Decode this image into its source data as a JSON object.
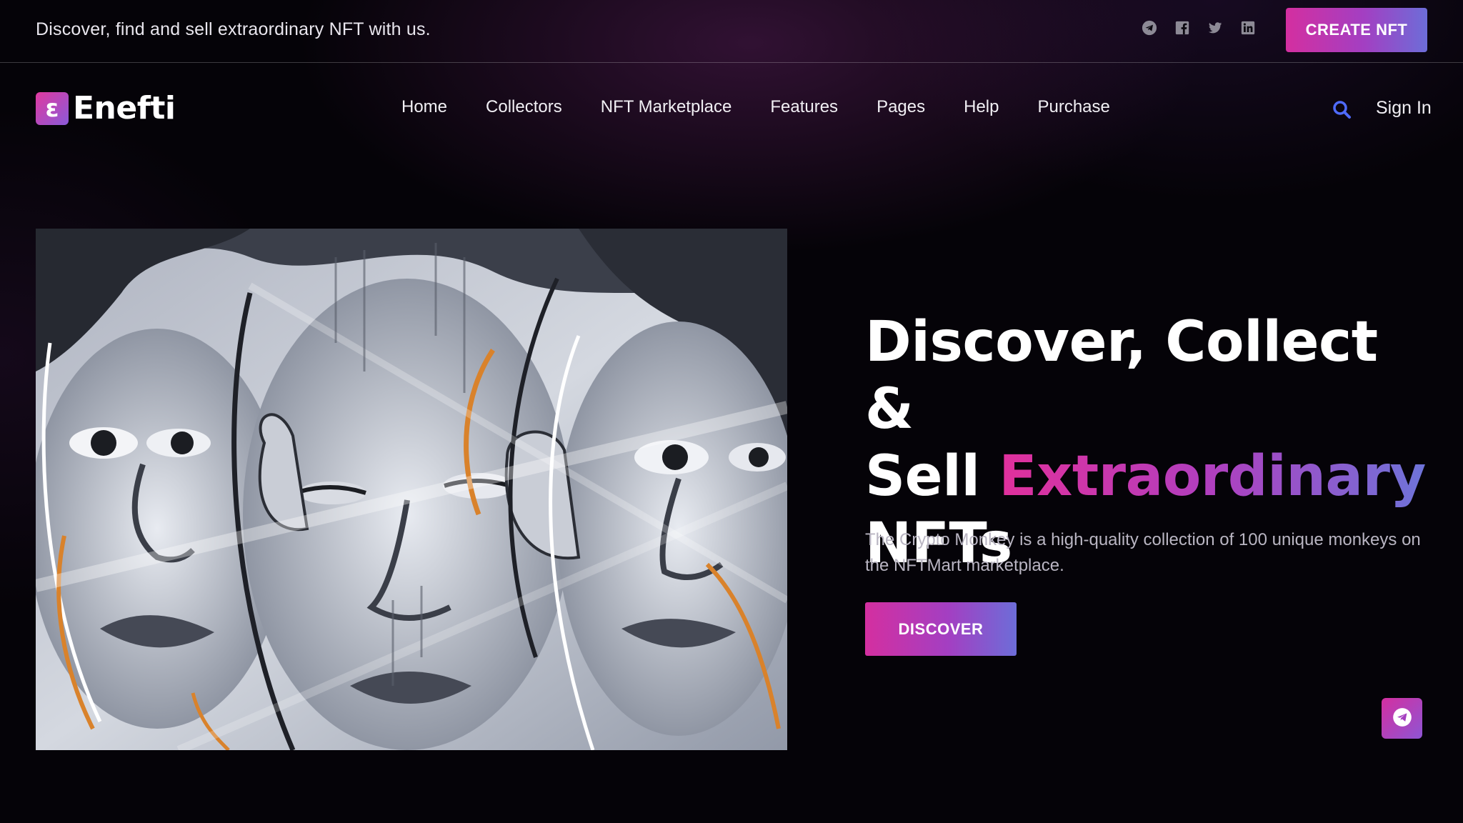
{
  "topbar": {
    "tagline": "Discover, find and sell extraordinary NFT with us.",
    "socials": [
      "telegram-icon",
      "facebook-icon",
      "twitter-icon",
      "linkedin-icon"
    ],
    "create_label": "CREATE NFT"
  },
  "logo": {
    "mark": "ɛ",
    "text": "Enefti"
  },
  "nav": {
    "items": [
      "Home",
      "Collectors",
      "NFT Marketplace",
      "Features",
      "Pages",
      "Help",
      "Purchase"
    ],
    "signin_label": "Sign In"
  },
  "hero": {
    "title_line1": "Discover, Collect &",
    "title_sell": "Sell ",
    "title_highlight": "Extraordinary",
    "title_line3": "NFTs",
    "description": "The Crypto Monkey is a high-quality collection of 100 unique monkeys on the NFTMart marketplace.",
    "cta_label": "DISCOVER",
    "image_icon": "graffiti-faces-artwork"
  },
  "floating": {
    "icon": "telegram-icon"
  },
  "colors": {
    "background": "#050308",
    "accent_pink": "#d42fa0",
    "accent_purple": "#a33fc2",
    "accent_blue": "#6d6dd8",
    "search_icon": "#4f6bff"
  }
}
